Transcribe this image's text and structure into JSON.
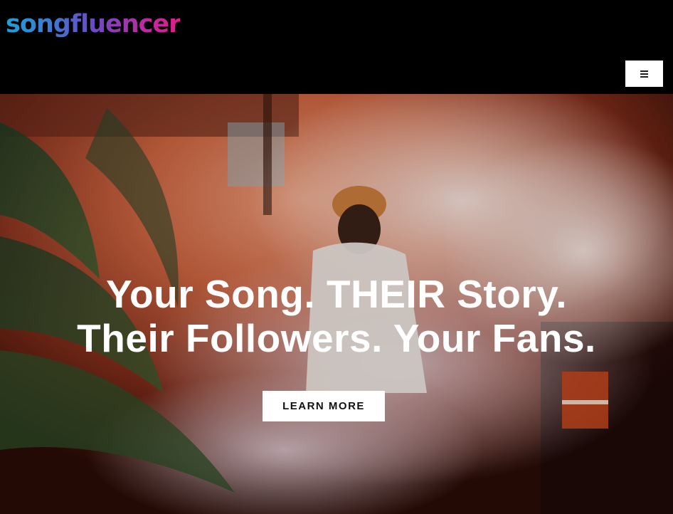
{
  "header": {
    "logo_text": "songfluencer",
    "menu_icon": "hamburger-menu-icon"
  },
  "hero": {
    "headline_line1": "Your Song. THEIR Story.",
    "headline_line2": "Their Followers. Your Fans.",
    "cta_label": "LEARN MORE"
  },
  "colors": {
    "header_bg": "#000000",
    "logo_gradient": [
      "#1ea0d8",
      "#6a4bc4",
      "#e51a8c"
    ],
    "button_bg": "#ffffff",
    "button_text": "#111111",
    "headline_text": "#ffffff"
  }
}
